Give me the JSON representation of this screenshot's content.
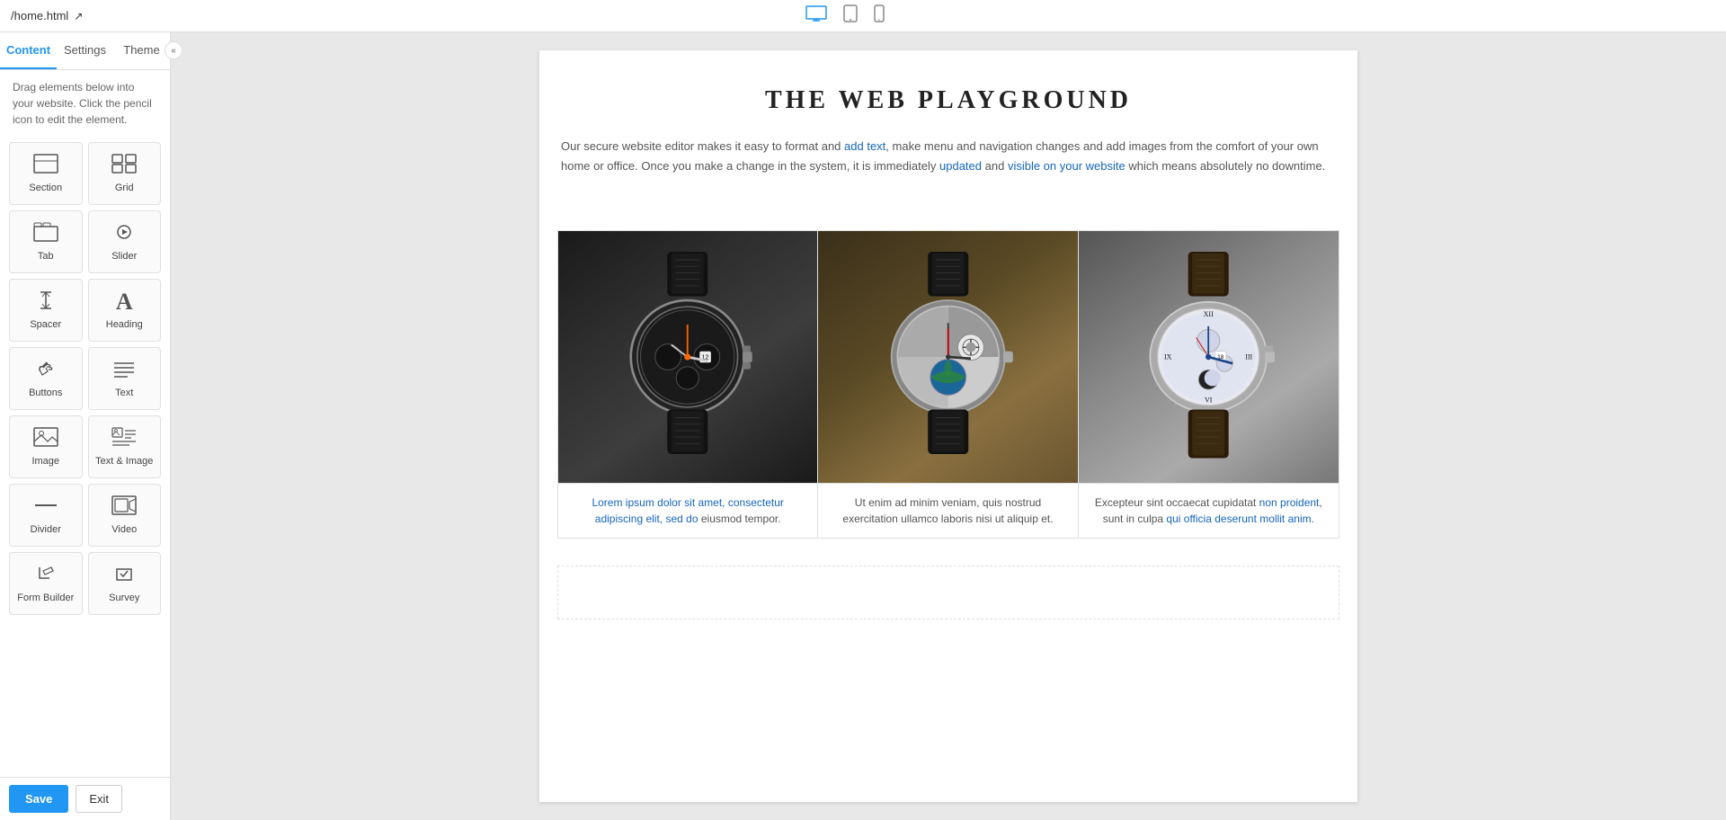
{
  "topbar": {
    "filename": "/home.html",
    "external_icon": "↗",
    "collapse_icon": "«"
  },
  "devices": [
    {
      "name": "desktop",
      "label": "Desktop",
      "icon": "🖥",
      "active": true
    },
    {
      "name": "tablet",
      "label": "Tablet",
      "icon": "▭",
      "active": false
    },
    {
      "name": "mobile",
      "label": "Mobile",
      "icon": "📱",
      "active": false
    }
  ],
  "sidebar": {
    "tabs": [
      {
        "id": "content",
        "label": "Content",
        "active": true
      },
      {
        "id": "settings",
        "label": "Settings",
        "active": false
      },
      {
        "id": "theme",
        "label": "Theme",
        "active": false
      }
    ],
    "description": "Drag elements below into your website. Click the pencil icon to edit the element.",
    "elements": [
      {
        "id": "section",
        "label": "Section",
        "icon": "⊞"
      },
      {
        "id": "grid",
        "label": "Grid",
        "icon": "⊟"
      },
      {
        "id": "tab",
        "label": "Tab",
        "icon": "▭"
      },
      {
        "id": "slider",
        "label": "Slider",
        "icon": "▶"
      },
      {
        "id": "spacer",
        "label": "Spacer",
        "icon": "↕"
      },
      {
        "id": "heading",
        "label": "Heading",
        "icon": "A"
      },
      {
        "id": "buttons",
        "label": "Buttons",
        "icon": "☞"
      },
      {
        "id": "text",
        "label": "Text",
        "icon": "≡"
      },
      {
        "id": "image",
        "label": "Image",
        "icon": "🖼"
      },
      {
        "id": "text-image",
        "label": "Text & Image",
        "icon": "🗌"
      },
      {
        "id": "divider",
        "label": "Divider",
        "icon": "—"
      },
      {
        "id": "video",
        "label": "Video",
        "icon": "⊡"
      },
      {
        "id": "form-builder",
        "label": "Form Builder",
        "icon": "✏"
      },
      {
        "id": "survey",
        "label": "Survey",
        "icon": "✓"
      }
    ],
    "save_label": "Save",
    "exit_label": "Exit"
  },
  "canvas": {
    "page_title": "THE WEB PLAYGROUND",
    "intro_text": "Our secure website editor makes it easy to format and add text, make menu and navigation changes and add images from the comfort of your own home or office. Once you make a change in the system, it is immediately updated and visible on your website which means absolutely no downtime.",
    "products": [
      {
        "id": "watch-1",
        "caption": "Lorem ipsum dolor sit amet, consectetur adipiscing elit, sed do eiusmod tempor.",
        "watch_color": "dark"
      },
      {
        "id": "watch-2",
        "caption": "Ut enim ad minim veniam, quis nostrud exercitation ullamco laboris nisi ut aliquip et.",
        "watch_color": "silver"
      },
      {
        "id": "watch-3",
        "caption": "Excepteur sint occaecat cupidatat non proident, sunt in culpa qui officia deserunt mollit anim.",
        "watch_color": "dark-silver"
      }
    ]
  }
}
